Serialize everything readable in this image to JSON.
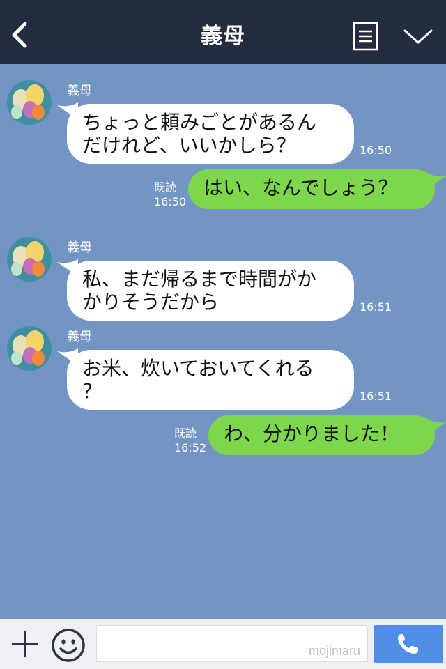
{
  "header": {
    "title": "義母",
    "back_icon": "chevron-left-icon",
    "menu_icon": "document-icon",
    "dropdown_icon": "chevron-down-icon"
  },
  "messages": [
    {
      "direction": "in",
      "sender": "義母",
      "lines": [
        "ちょっと頼みごとがあるん",
        "だけれど、いいかしら？"
      ],
      "time": "16:50"
    },
    {
      "direction": "out",
      "text": "はい、なんでしょう？",
      "read": "既読",
      "time": "16:50"
    },
    {
      "direction": "in",
      "sender": "義母",
      "lines": [
        "私、まだ帰るまで時間がか",
        "かりそうだから"
      ],
      "time": "16:51"
    },
    {
      "direction": "in",
      "sender": "義母",
      "lines": [
        "お米、炊いておいてくれる",
        "？"
      ],
      "time": "16:51"
    },
    {
      "direction": "out",
      "text": "わ、分かりました！",
      "read": "既読",
      "time": "16:52"
    }
  ],
  "inputbar": {
    "add_icon": "plus-icon",
    "emoji_icon": "smile-icon",
    "placeholder": "",
    "watermark": "mojimaru",
    "call_icon": "phone-icon"
  },
  "colors": {
    "header_bg": "#242c40",
    "chat_bg": "#7395c4",
    "incoming_bubble": "#ffffff",
    "outgoing_bubble": "#7ed64c",
    "call_button": "#4f8ee6"
  }
}
